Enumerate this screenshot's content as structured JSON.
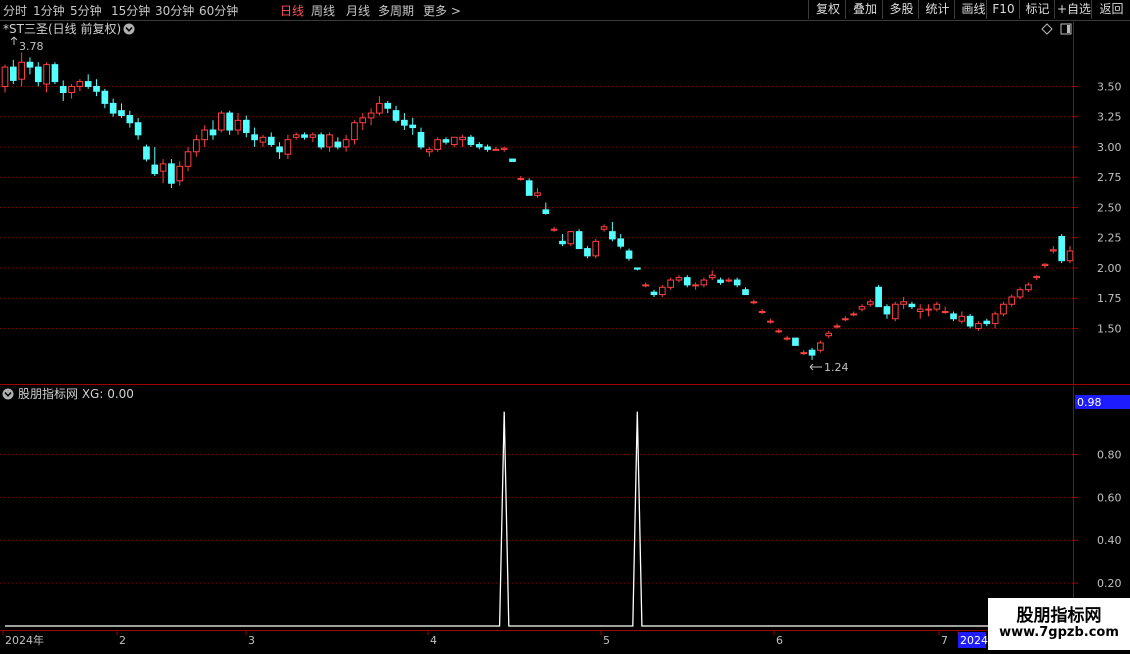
{
  "toolbar": {
    "periods": [
      "分时",
      "1分钟",
      "5分钟",
      "15分钟",
      "30分钟",
      "60分钟",
      "日线",
      "周线",
      "月线",
      "多周期",
      "更多 >"
    ],
    "active_period": "日线",
    "tools": [
      "复权",
      "叠加",
      "多股",
      "统计",
      "画线",
      "F10",
      "标记",
      "+自选",
      "返回"
    ]
  },
  "main": {
    "title": "*ST三圣(日线 前复权)",
    "high_label": "3.78",
    "low_label": "1.24"
  },
  "indicator": {
    "title": "股朋指标网 XG: 0.00",
    "current_value": "0.98"
  },
  "colors": {
    "up": "#ff4040",
    "down": "#54ffff",
    "grid": "#8b0000",
    "border": "#a00000",
    "line": "#ffffff",
    "highlight": "#1c1cff"
  },
  "watermark": {
    "title": "股朋指标网",
    "url": "www.7gpzb.com"
  },
  "chart_data": [
    {
      "type": "candlestick",
      "ylim": [
        1.14,
        3.95
      ],
      "ytick_labels": [
        "1.50",
        "1.75",
        "2.00",
        "2.25",
        "2.50",
        "2.75",
        "3.00",
        "3.25",
        "3.50"
      ],
      "x_labels": [
        "2024年",
        "2",
        "3",
        "4",
        "5",
        "6",
        "7",
        "2024"
      ],
      "ohlc": [
        [
          3.5,
          3.68,
          3.45,
          3.66
        ],
        [
          3.66,
          3.72,
          3.52,
          3.55
        ],
        [
          3.56,
          3.78,
          3.5,
          3.7
        ],
        [
          3.7,
          3.74,
          3.6,
          3.66
        ],
        [
          3.66,
          3.7,
          3.5,
          3.54
        ],
        [
          3.52,
          3.7,
          3.45,
          3.68
        ],
        [
          3.68,
          3.7,
          3.52,
          3.54
        ],
        [
          3.5,
          3.55,
          3.38,
          3.45
        ],
        [
          3.45,
          3.52,
          3.4,
          3.5
        ],
        [
          3.5,
          3.56,
          3.46,
          3.54
        ],
        [
          3.54,
          3.6,
          3.48,
          3.5
        ],
        [
          3.5,
          3.56,
          3.42,
          3.46
        ],
        [
          3.46,
          3.48,
          3.32,
          3.36
        ],
        [
          3.36,
          3.4,
          3.25,
          3.28
        ],
        [
          3.3,
          3.36,
          3.24,
          3.26
        ],
        [
          3.26,
          3.3,
          3.16,
          3.2
        ],
        [
          3.2,
          3.24,
          3.06,
          3.1
        ],
        [
          3.0,
          3.02,
          2.88,
          2.9
        ],
        [
          2.85,
          3.0,
          2.76,
          2.78
        ],
        [
          2.8,
          2.9,
          2.7,
          2.86
        ],
        [
          2.86,
          2.9,
          2.66,
          2.7
        ],
        [
          2.72,
          2.88,
          2.68,
          2.84
        ],
        [
          2.84,
          3.0,
          2.8,
          2.96
        ],
        [
          2.96,
          3.1,
          2.92,
          3.06
        ],
        [
          3.06,
          3.18,
          3.0,
          3.14
        ],
        [
          3.14,
          3.22,
          3.06,
          3.1
        ],
        [
          3.14,
          3.3,
          3.12,
          3.28
        ],
        [
          3.28,
          3.3,
          3.1,
          3.14
        ],
        [
          3.14,
          3.28,
          3.1,
          3.22
        ],
        [
          3.22,
          3.26,
          3.08,
          3.12
        ],
        [
          3.1,
          3.16,
          3.0,
          3.06
        ],
        [
          3.04,
          3.1,
          3.0,
          3.08
        ],
        [
          3.08,
          3.12,
          3.0,
          3.02
        ],
        [
          3.0,
          3.04,
          2.9,
          2.96
        ],
        [
          2.94,
          3.1,
          2.9,
          3.06
        ],
        [
          3.08,
          3.12,
          3.06,
          3.1
        ],
        [
          3.1,
          3.12,
          3.06,
          3.08
        ],
        [
          3.08,
          3.12,
          3.04,
          3.1
        ],
        [
          3.1,
          3.12,
          2.98,
          3.0
        ],
        [
          3.0,
          3.12,
          2.96,
          3.1
        ],
        [
          3.04,
          3.08,
          2.98,
          3.0
        ],
        [
          3.0,
          3.1,
          2.96,
          3.06
        ],
        [
          3.06,
          3.22,
          3.02,
          3.2
        ],
        [
          3.2,
          3.28,
          3.14,
          3.24
        ],
        [
          3.24,
          3.32,
          3.18,
          3.28
        ],
        [
          3.28,
          3.42,
          3.26,
          3.36
        ],
        [
          3.36,
          3.38,
          3.28,
          3.32
        ],
        [
          3.3,
          3.34,
          3.2,
          3.22
        ],
        [
          3.22,
          3.28,
          3.14,
          3.18
        ],
        [
          3.18,
          3.24,
          3.1,
          3.16
        ],
        [
          3.12,
          3.16,
          2.98,
          3.0
        ],
        [
          2.96,
          3.0,
          2.92,
          2.98
        ],
        [
          2.98,
          3.08,
          2.96,
          3.06
        ],
        [
          3.06,
          3.08,
          3.02,
          3.04
        ],
        [
          3.02,
          3.08,
          3.0,
          3.08
        ],
        [
          3.06,
          3.1,
          3.0,
          3.08
        ],
        [
          3.08,
          3.1,
          3.0,
          3.02
        ],
        [
          3.02,
          3.04,
          2.98,
          3.0
        ],
        [
          3.0,
          3.02,
          2.96,
          2.98
        ],
        [
          2.98,
          3.0,
          2.97,
          2.98
        ],
        [
          2.98,
          3.0,
          2.96,
          2.99
        ],
        [
          2.9,
          2.9,
          2.88,
          2.88
        ],
        [
          2.74,
          2.76,
          2.72,
          2.74
        ],
        [
          2.72,
          2.74,
          2.6,
          2.6
        ],
        [
          2.6,
          2.66,
          2.58,
          2.62
        ],
        [
          2.48,
          2.54,
          2.44,
          2.45
        ],
        [
          2.32,
          2.34,
          2.3,
          2.32
        ],
        [
          2.22,
          2.28,
          2.18,
          2.2
        ],
        [
          2.2,
          2.3,
          2.18,
          2.3
        ],
        [
          2.3,
          2.32,
          2.16,
          2.16
        ],
        [
          2.16,
          2.18,
          2.08,
          2.1
        ],
        [
          2.1,
          2.24,
          2.08,
          2.22
        ],
        [
          2.32,
          2.36,
          2.3,
          2.34
        ],
        [
          2.3,
          2.38,
          2.22,
          2.24
        ],
        [
          2.24,
          2.28,
          2.16,
          2.18
        ],
        [
          2.14,
          2.16,
          2.06,
          2.08
        ],
        [
          2.0,
          2.0,
          1.98,
          1.99
        ],
        [
          1.86,
          1.88,
          1.84,
          1.86
        ],
        [
          1.8,
          1.82,
          1.76,
          1.78
        ],
        [
          1.78,
          1.86,
          1.76,
          1.84
        ],
        [
          1.84,
          1.92,
          1.82,
          1.9
        ],
        [
          1.9,
          1.94,
          1.88,
          1.92
        ],
        [
          1.92,
          1.94,
          1.84,
          1.86
        ],
        [
          1.86,
          1.88,
          1.82,
          1.86
        ],
        [
          1.86,
          1.92,
          1.84,
          1.9
        ],
        [
          1.92,
          1.98,
          1.9,
          1.94
        ],
        [
          1.9,
          1.92,
          1.86,
          1.88
        ],
        [
          1.9,
          1.92,
          1.88,
          1.9
        ],
        [
          1.9,
          1.92,
          1.84,
          1.86
        ],
        [
          1.82,
          1.84,
          1.78,
          1.78
        ],
        [
          1.72,
          1.74,
          1.7,
          1.72
        ],
        [
          1.64,
          1.66,
          1.62,
          1.64
        ],
        [
          1.56,
          1.58,
          1.54,
          1.56
        ],
        [
          1.48,
          1.5,
          1.46,
          1.48
        ],
        [
          1.42,
          1.44,
          1.4,
          1.42
        ],
        [
          1.42,
          1.42,
          1.36,
          1.36
        ],
        [
          1.3,
          1.32,
          1.28,
          1.3
        ],
        [
          1.32,
          1.34,
          1.24,
          1.28
        ],
        [
          1.32,
          1.4,
          1.3,
          1.38
        ],
        [
          1.44,
          1.48,
          1.42,
          1.46
        ],
        [
          1.52,
          1.54,
          1.5,
          1.52
        ],
        [
          1.58,
          1.6,
          1.56,
          1.58
        ],
        [
          1.62,
          1.64,
          1.6,
          1.62
        ],
        [
          1.66,
          1.7,
          1.64,
          1.68
        ],
        [
          1.7,
          1.74,
          1.68,
          1.72
        ],
        [
          1.84,
          1.86,
          1.68,
          1.68
        ],
        [
          1.68,
          1.7,
          1.58,
          1.62
        ],
        [
          1.58,
          1.72,
          1.56,
          1.7
        ],
        [
          1.7,
          1.76,
          1.66,
          1.72
        ],
        [
          1.7,
          1.72,
          1.66,
          1.68
        ],
        [
          1.64,
          1.7,
          1.58,
          1.66
        ],
        [
          1.66,
          1.7,
          1.6,
          1.66
        ],
        [
          1.66,
          1.72,
          1.64,
          1.7
        ],
        [
          1.64,
          1.68,
          1.62,
          1.64
        ],
        [
          1.62,
          1.64,
          1.56,
          1.58
        ],
        [
          1.56,
          1.64,
          1.54,
          1.6
        ],
        [
          1.6,
          1.62,
          1.5,
          1.52
        ],
        [
          1.5,
          1.56,
          1.48,
          1.54
        ],
        [
          1.56,
          1.58,
          1.52,
          1.54
        ],
        [
          1.54,
          1.64,
          1.5,
          1.62
        ],
        [
          1.62,
          1.72,
          1.6,
          1.7
        ],
        [
          1.7,
          1.78,
          1.68,
          1.76
        ],
        [
          1.76,
          1.84,
          1.74,
          1.82
        ],
        [
          1.82,
          1.88,
          1.8,
          1.86
        ],
        [
          1.92,
          1.94,
          1.9,
          1.93
        ],
        [
          2.02,
          2.04,
          2.0,
          2.03
        ],
        [
          2.14,
          2.18,
          2.12,
          2.15
        ],
        [
          2.26,
          2.28,
          2.04,
          2.06
        ],
        [
          2.06,
          2.18,
          2.04,
          2.14
        ]
      ]
    },
    {
      "type": "line",
      "name": "XG",
      "ylim": [
        0,
        1.04
      ],
      "ytick_labels": [
        "0.20",
        "0.40",
        "0.60",
        "0.80"
      ],
      "pulses_at_bar": [
        60,
        76
      ],
      "values": [
        0,
        0,
        0,
        0,
        0,
        0,
        0,
        0,
        0,
        0,
        0,
        0,
        0,
        0,
        0,
        0,
        0,
        0,
        0,
        0,
        0,
        0,
        0,
        0,
        0,
        0,
        0,
        0,
        0,
        0,
        0,
        0,
        0,
        0,
        0,
        0,
        0,
        0,
        0,
        0,
        0,
        0,
        0,
        0,
        0,
        0,
        0,
        0,
        0,
        0,
        0,
        0,
        0,
        0,
        0,
        0,
        0,
        0,
        0,
        0,
        1,
        0,
        0,
        0,
        0,
        0,
        0,
        0,
        0,
        0,
        0,
        0,
        0,
        0,
        0,
        0,
        1,
        0,
        0,
        0,
        0,
        0,
        0,
        0,
        0,
        0,
        0,
        0,
        0,
        0,
        0,
        0,
        0,
        0,
        0,
        0,
        0,
        0,
        0,
        0,
        0,
        0,
        0,
        0,
        0,
        0,
        0,
        0,
        0,
        0,
        0,
        0,
        0,
        0,
        0,
        0,
        0,
        0,
        0,
        0,
        0,
        0,
        0,
        0,
        0,
        0,
        0,
        0,
        0,
        0,
        0
      ]
    }
  ]
}
